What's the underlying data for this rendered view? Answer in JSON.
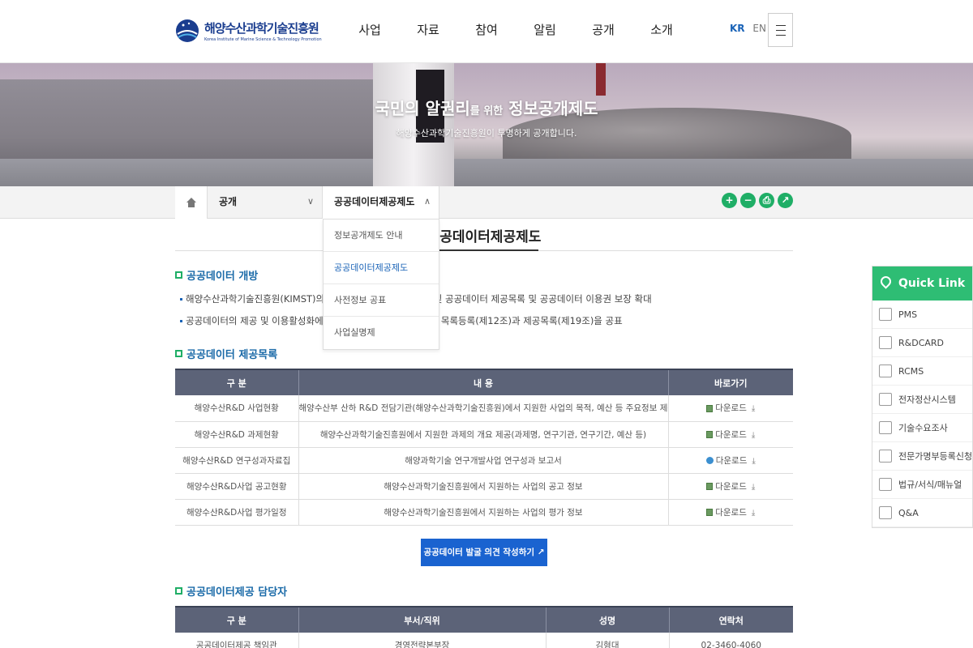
{
  "header": {
    "logo_ko": "해양수산과학기술진흥원",
    "logo_en": "Korea Institute of Marine Science & Technology Promotion",
    "nav": [
      "사업",
      "자료",
      "참여",
      "알림",
      "공개",
      "소개"
    ],
    "lang_kr": "KR",
    "lang_en": "EN"
  },
  "hero": {
    "title_a": "국민의 알권리",
    "title_b": "를 위한",
    "title_c": "정보공개제도",
    "subtitle": "해양수산과학기술진흥원이 투명하게 공개합니다."
  },
  "location": {
    "depth1": "공개",
    "depth2": "공공데이터제공제도",
    "tools": [
      "+",
      "−",
      "⎙",
      "↗"
    ]
  },
  "dropdown": {
    "items": [
      "정보공개제도 안내",
      "공공데이터제공제도",
      "사전정보 공표",
      "사업실명제"
    ]
  },
  "content": {
    "page_title": "공공데이터제공제도",
    "sec1_title": "공공데이터 개방",
    "bullet1": "해양수산과학기술진흥원(KIMST)의 공공데이터 개방 범위 확대 및 공공데이터 제공목록 및 공공데이터 이용권 보장 확대",
    "bullet2": "공공데이터의 제공 및 이용활성화에 관한 법률에 따른 공공데이터 목록등록(제12조)과 제공목록(제19조)을 공표",
    "sec2_title": "공공데이터 제공목록",
    "table1_headers": [
      "구 분",
      "내 용",
      "바로가기"
    ],
    "table1_rows": [
      {
        "cat": "해양수산R&D 사업현황",
        "desc": "해양수산부 산하 R&D 전담기관(해양수산과학기술진흥원)에서 지원한 사업의 목적, 예산 등 주요정보 제공",
        "link": "다운로드"
      },
      {
        "cat": "해양수산R&D 과제현황",
        "desc": "해양수산과학기술진흥원에서 지원한 과제의 개요 제공(과제명, 연구기관, 연구기간, 예산 등)",
        "link": "다운로드"
      },
      {
        "cat": "해양수산R&D 연구성과자료집",
        "desc": "해양과학기술 연구개발사업 연구성과 보고서",
        "link": "다운로드"
      },
      {
        "cat": "해양수산R&D사업 공고현황",
        "desc": "해양수산과학기술진흥원에서 지원하는 사업의 공고 정보",
        "link": "다운로드"
      },
      {
        "cat": "해양수산R&D사업 평가일정",
        "desc": "해양수산과학기술진흥원에서 지원하는 사업의 평가 정보",
        "link": "다운로드"
      }
    ],
    "cta": "공공데이터 발굴 의견 작성하기",
    "sec3_title": "공공데이터제공 담당자",
    "table2_headers": [
      "구 분",
      "부서/직위",
      "성명",
      "연락처"
    ],
    "table2_row": {
      "cat": "공공데이터제공 책임관",
      "dept": "경영전략본부장",
      "name": "김형대",
      "phone": "02-3460-4060"
    }
  },
  "quick": {
    "title": "Quick Link",
    "items": [
      "PMS",
      "R&DCARD",
      "RCMS",
      "전자정산시스템",
      "기술수요조사",
      "전문가명부등록신청",
      "법규/서식/매뉴얼",
      "Q&A"
    ]
  }
}
